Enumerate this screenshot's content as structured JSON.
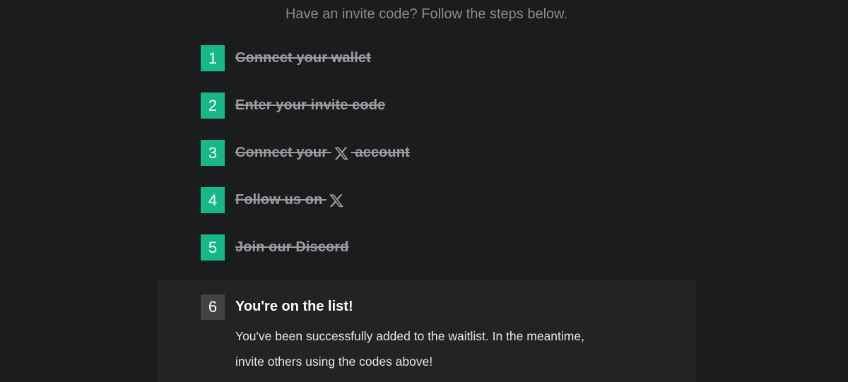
{
  "header": {
    "subtitle": "Have an invite code? Follow the steps below."
  },
  "steps": [
    {
      "number": "1",
      "label": "Connect your wallet",
      "completed": true
    },
    {
      "number": "2",
      "label": "Enter your invite code",
      "completed": true
    },
    {
      "number": "3",
      "label_before": "Connect your ",
      "icon": "x-logo-icon",
      "label_after": " account",
      "completed": true
    },
    {
      "number": "4",
      "label_before": "Follow us on ",
      "icon": "x-logo-icon",
      "completed": true
    },
    {
      "number": "5",
      "label": "Join our Discord",
      "completed": true
    }
  ],
  "final_step": {
    "number": "6",
    "title": "You're on the list!",
    "body_line1": "You've been successfully added to the waitlist. In the meantime,",
    "body_line2": "invite others using the codes above!"
  },
  "colors": {
    "background": "#1b1c1e",
    "completed_badge": "#16b886",
    "current_badge": "#424345",
    "panel": "#222324"
  }
}
